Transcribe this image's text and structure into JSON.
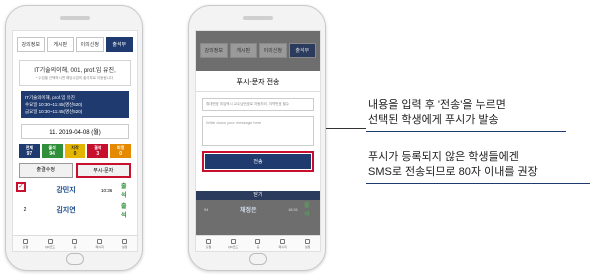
{
  "left_phone": {
    "tabs": [
      "강의정보",
      "게시판",
      "이의신청",
      "출석부"
    ],
    "active_tab": 3,
    "course_title": "IT기술의이해, 001, prof.임 유진,",
    "course_note": "* 수업을 선택하시면 해당수업의 출석부로 이동됩니다.",
    "schedule": [
      "IT기술의이해, prof.임 유진",
      "수요일 10:30~11:45(명신520)",
      "금요일 10:30~11:45(명신520)"
    ],
    "date": "11. 2019-04-08 (월)",
    "stats": [
      {
        "label": "전체",
        "value": "97",
        "color": "#1e3a6e"
      },
      {
        "label": "출석",
        "value": "94",
        "color": "#2f8f3a"
      },
      {
        "label": "지각",
        "value": "0",
        "color": "#e3b400"
      },
      {
        "label": "결석",
        "value": "3",
        "color": "#c8102e"
      },
      {
        "label": "미정",
        "value": "0",
        "color": "#e58a00"
      }
    ],
    "actions": [
      "출결수정",
      "푸시-문자"
    ],
    "students": [
      {
        "num": "1",
        "name": "강민지",
        "time": "10:36",
        "status": "출석"
      },
      {
        "num": "2",
        "name": "김지연",
        "time": "",
        "status": "출석"
      }
    ],
    "nav": [
      "출결",
      "QR코드",
      "홈",
      "메시지",
      "설정"
    ]
  },
  "right_phone": {
    "tabs": [
      "강의정보",
      "게시판",
      "이의신청",
      "출석부"
    ],
    "active_tab": 3,
    "modal_title": "푸시-문자 전송",
    "phone_placeholder": "휴대번호 미입력시 교수님번호로 자동처리, 지역번호 필수",
    "message_placeholder": "Write down your message here",
    "send_label": "전송",
    "close_label": "닫기",
    "behind_rows": [
      {
        "num": "94",
        "name": "채정은",
        "time": "18:31",
        "status": "출석"
      },
      {
        "num": "",
        "name": "",
        "time": "",
        "status": ""
      }
    ],
    "nav": [
      "출결",
      "QR코드",
      "홈",
      "메시지",
      "설정"
    ]
  },
  "annotations": [
    [
      "내용을 입력 후 '전송'을 누르면",
      "선택된 학생에게 푸시가 발송"
    ],
    [
      "푸시가 등록되지 않은 학생들에겐",
      "SMS로 전송되므로 80자 이내를 권장"
    ]
  ]
}
